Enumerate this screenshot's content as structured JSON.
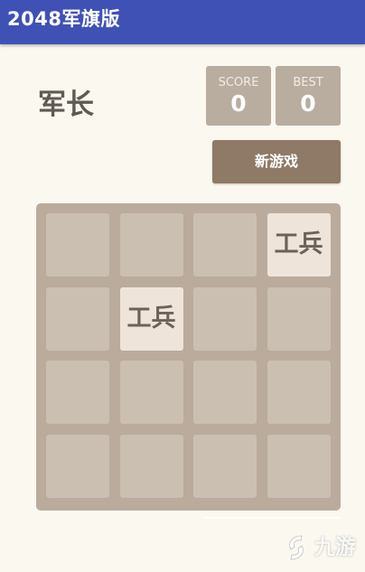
{
  "app": {
    "title": "2048军旗版"
  },
  "header": {
    "rank_label": "军长"
  },
  "scores": {
    "score_label": "SCORE",
    "score_value": "0",
    "best_label": "BEST",
    "best_value": "0"
  },
  "actions": {
    "new_game_label": "新游戏"
  },
  "board": {
    "rows": 4,
    "cols": 4,
    "tiles": [
      {
        "row": 0,
        "col": 3,
        "label": "工兵"
      },
      {
        "row": 1,
        "col": 1,
        "label": "工兵"
      }
    ]
  },
  "watermark": {
    "text": "九游"
  },
  "colors": {
    "appbar": "#3f51b5",
    "background": "#fbf8ef",
    "board": "#baab9c",
    "empty_cell": "#cbbfb2",
    "tile": "#eee4da",
    "new_game_button": "#8f7a67",
    "score_box": "#b9ada0"
  }
}
